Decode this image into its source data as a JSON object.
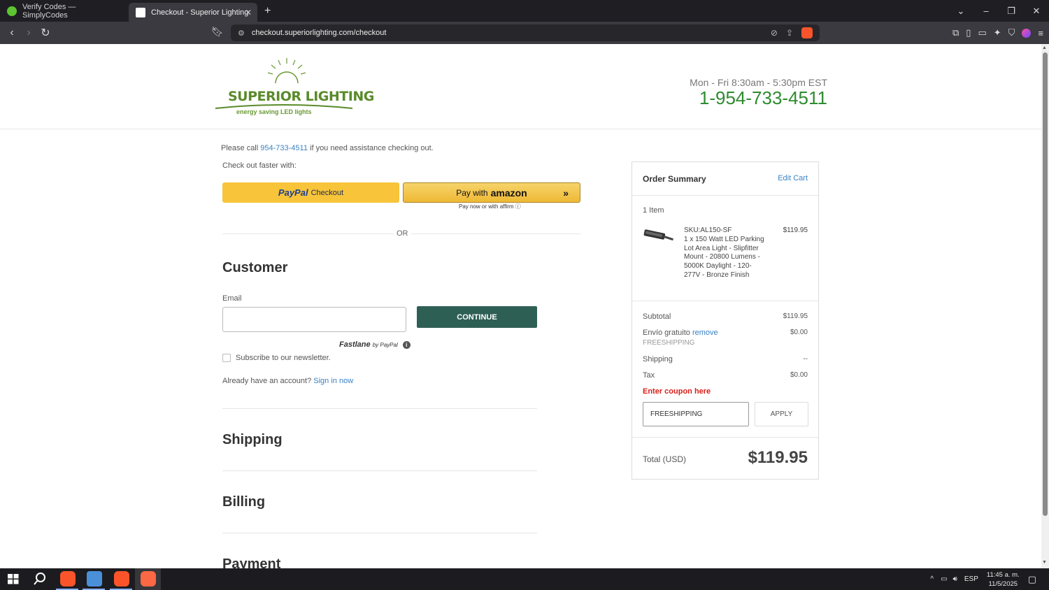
{
  "browser": {
    "tabs": [
      {
        "label": "Verify Codes — SimplyCodes",
        "active": false
      },
      {
        "label": "Checkout - Superior Lighting",
        "active": true
      }
    ],
    "url": "checkout.superiorlighting.com/checkout"
  },
  "header": {
    "logo_brand": "SUPERIOR LIGHTING",
    "logo_tagline": "energy saving  LED lights",
    "hours": "Mon - Fri 8:30am - 5:30pm EST",
    "phone": "1-954-733-4511"
  },
  "checkout": {
    "help_prefix": "Please call ",
    "help_phone": "954-733-4511",
    "help_suffix": " if you need assistance checking out.",
    "faster": "Check out faster with:",
    "paypal_logo": "PayPal",
    "paypal_checkout": "Checkout",
    "amazon_pay": "Pay with",
    "amazon_brand": "amazon",
    "affirm_note": "Pay now or with affirm",
    "or": "OR",
    "customer_heading": "Customer",
    "email_label": "Email",
    "email_value": "",
    "continue": "CONTINUE",
    "fastlane": "Fastlane",
    "fastlane_by": "by PayPal",
    "newsletter": "Subscribe to our newsletter.",
    "account_prefix": "Already have an account? ",
    "sign_in": "Sign in now",
    "shipping_heading": "Shipping",
    "billing_heading": "Billing",
    "payment_heading": "Payment"
  },
  "summary": {
    "title": "Order Summary",
    "edit_cart": "Edit Cart",
    "items_count": "1 Item",
    "sku": "SKU:AL150-SF",
    "description": "1 x 150 Watt LED Parking Lot Area Light - Slipfitter Mount - 20800 Lumens - 5000K Daylight - 120-277V - Bronze Finish",
    "price": "$119.95",
    "subtotal_label": "Subtotal",
    "subtotal": "$119.95",
    "free_shipping_label": "Envío gratuito",
    "remove": "remove",
    "free_shipping_code": "FREESHIPPING",
    "free_shipping_value": "$0.00",
    "shipping_label": "Shipping",
    "shipping_value": "--",
    "tax_label": "Tax",
    "tax_value": "$0.00",
    "coupon_label": "Enter coupon here",
    "coupon_value": "FREESHIPPING",
    "apply": "APPLY",
    "total_label": "Total (USD)",
    "total": "$119.95"
  },
  "taskbar": {
    "language": "ESP",
    "time": "11:45 a. m.",
    "date": "11/5/2025"
  },
  "colors": {
    "accent_green": "#2e8b2e",
    "continue_button": "#2e5f55",
    "coupon_red": "#d91e18",
    "link_blue": "#3a82c4"
  }
}
